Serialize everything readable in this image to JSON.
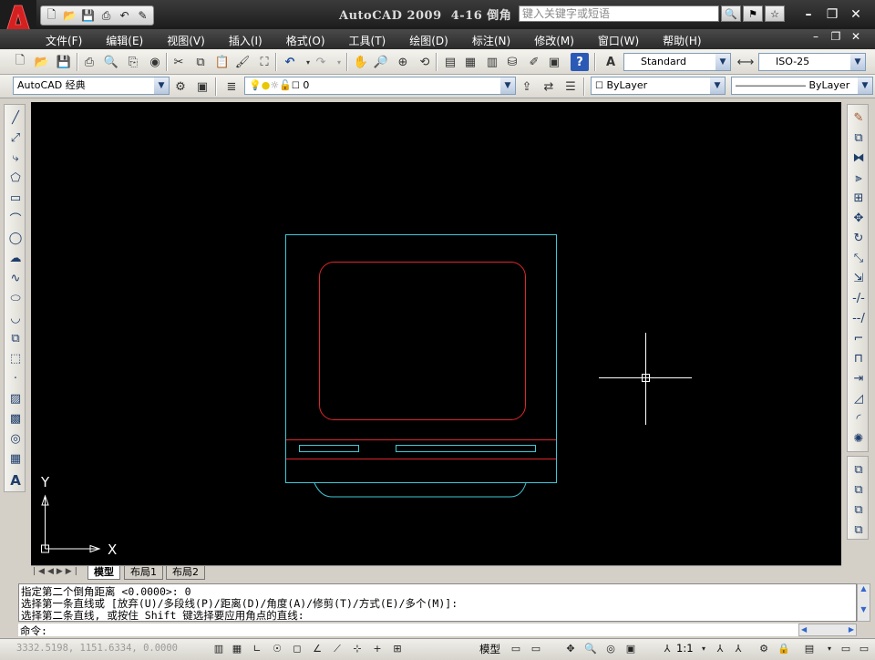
{
  "title": {
    "app": "AutoCAD 2009",
    "document": "4-16 倒角"
  },
  "search": {
    "placeholder": "键入关键字或短语"
  },
  "menu": {
    "items": [
      "文件(F)",
      "编辑(E)",
      "视图(V)",
      "插入(I)",
      "格式(O)",
      "工具(T)",
      "绘图(D)",
      "标注(N)",
      "修改(M)",
      "窗口(W)",
      "帮助(H)"
    ]
  },
  "toolbar": {
    "text_style": "Standard",
    "dim_style": "ISO-25",
    "workspace": "AutoCAD 经典",
    "layer": "0",
    "color": "ByLayer",
    "linetype": "ByLayer"
  },
  "ucs": {
    "x_label": "X",
    "y_label": "Y"
  },
  "tabs": [
    "模型",
    "布局1",
    "布局2"
  ],
  "command": {
    "lines": [
      "指定第二个倒角距离 <0.0000>: 0",
      "选择第一条直线或 [放弃(U)/多段线(P)/距离(D)/角度(A)/修剪(T)/方式(E)/多个(M)]:",
      "选择第二条直线, 或按住 Shift 键选择要应用角点的直线:"
    ],
    "prompt": "命令:"
  },
  "status": {
    "coords": "3332.5198, 1151.6334, 0.0000",
    "model_label": "模型",
    "scale": "1:1"
  },
  "colors": {
    "canvas": "#000000",
    "cyan_outline": "#3fc8d6",
    "red_outline": "#e0262b"
  }
}
